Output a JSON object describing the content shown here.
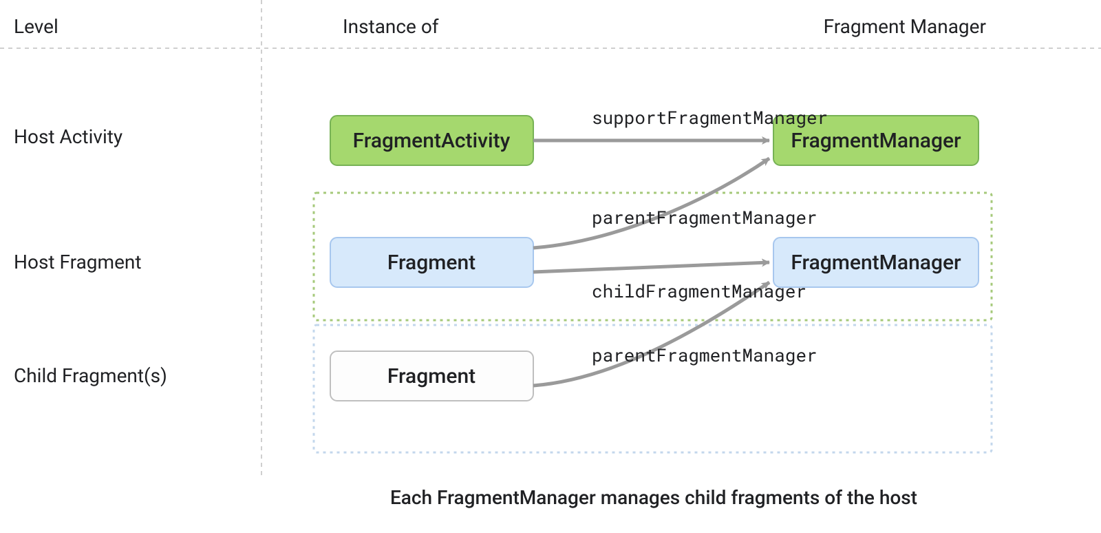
{
  "headers": {
    "level": "Level",
    "instance_of": "Instance of",
    "fragment_manager": "Fragment Manager"
  },
  "rows": {
    "host_activity": "Host Activity",
    "host_fragment": "Host Fragment",
    "child_fragments": "Child Fragment(s)"
  },
  "boxes": {
    "fragment_activity": "FragmentActivity",
    "fragment_manager_top": "FragmentManager",
    "fragment_mid": "Fragment",
    "fragment_manager_mid": "FragmentManager",
    "fragment_bottom": "Fragment"
  },
  "edges": {
    "support_fm": "supportFragmentManager",
    "parent_fm_1": "parentFragmentManager",
    "child_fm": "childFragmentManager",
    "parent_fm_2": "parentFragmentManager"
  },
  "caption": "Each FragmentManager manages child fragments of the host",
  "colors": {
    "green_fill": "#a5d86e",
    "green_stroke": "#77b255",
    "blue_fill": "#d7e9fb",
    "blue_stroke": "#a7c7ee",
    "gray_fill": "#fdfdfd",
    "gray_stroke": "#bfbfbf",
    "arrow": "#9a9a9a",
    "dashed": "#bfbfbf",
    "green_dashed": "#a5c97a",
    "blue_dashed": "#c3d7ec"
  }
}
